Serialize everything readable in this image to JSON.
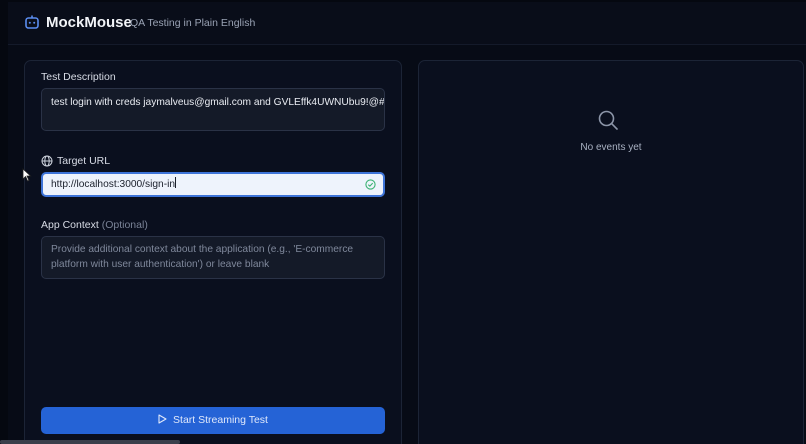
{
  "header": {
    "brand": "MockMouse",
    "tagline": "QA Testing in Plain English"
  },
  "form": {
    "description_label": "Test Description",
    "description_value": "test login with creds jaymalveus@gmail.com and GVLEffk4UWNUbu9!@#",
    "url_label": "Target URL",
    "url_value": "http://localhost:3000/sign-in",
    "context_label": "App Context",
    "context_optional": "(Optional)",
    "context_placeholder": "Provide additional context about the application (e.g., 'E-commerce platform with user authentication') or leave blank",
    "start_button": "Start Streaming Test"
  },
  "events": {
    "empty_text": "No events yet"
  },
  "colors": {
    "accent": "#2563d6",
    "valid": "#3bb273"
  }
}
